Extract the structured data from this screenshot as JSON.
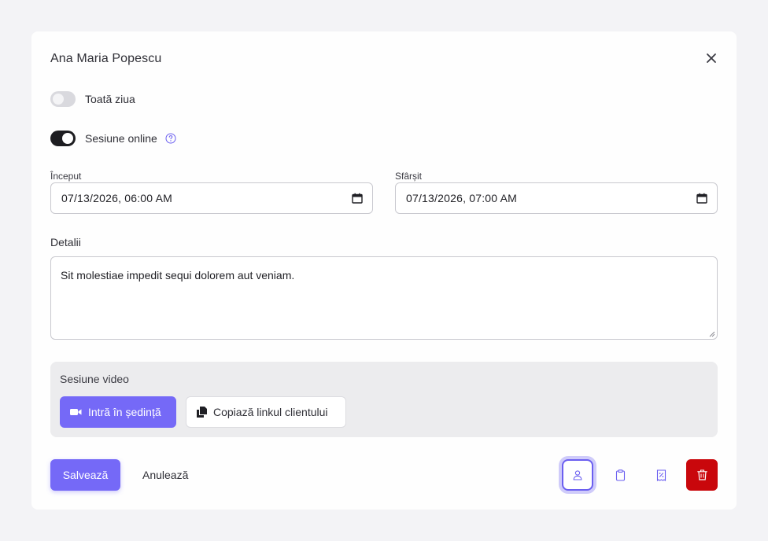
{
  "dialog": {
    "title": "Ana Maria Popescu"
  },
  "toggles": {
    "all_day": {
      "label": "Toată ziua",
      "on": false
    },
    "online_session": {
      "label": "Sesiune online",
      "on": true
    }
  },
  "fields": {
    "start": {
      "label": "Început",
      "value": "07/13/2026, 06:00 AM"
    },
    "end": {
      "label": "Sfârșit",
      "value": "07/13/2026, 07:00 AM"
    },
    "details": {
      "label": "Detalii",
      "value": "Sit molestiae impedit sequi dolorem aut veniam."
    }
  },
  "video_session": {
    "title": "Sesiune video",
    "join_label": "Intră în ședință",
    "copy_label": "Copiază linkul clientului"
  },
  "footer": {
    "save_label": "Salvează",
    "cancel_label": "Anulează"
  },
  "icons": {
    "close": "close-icon",
    "help": "help-circle-icon",
    "video": "video-camera-icon",
    "copy": "copy-icon",
    "calendar": "calendar-icon",
    "client": "user-icon",
    "notes": "clipboard-icon",
    "invoice": "receipt-icon",
    "delete": "trash-icon"
  },
  "colors": {
    "accent": "#7569f7",
    "danger": "#c9070c",
    "toggle_on": "#1d1d21",
    "help_icon": "#6b5ff0"
  }
}
